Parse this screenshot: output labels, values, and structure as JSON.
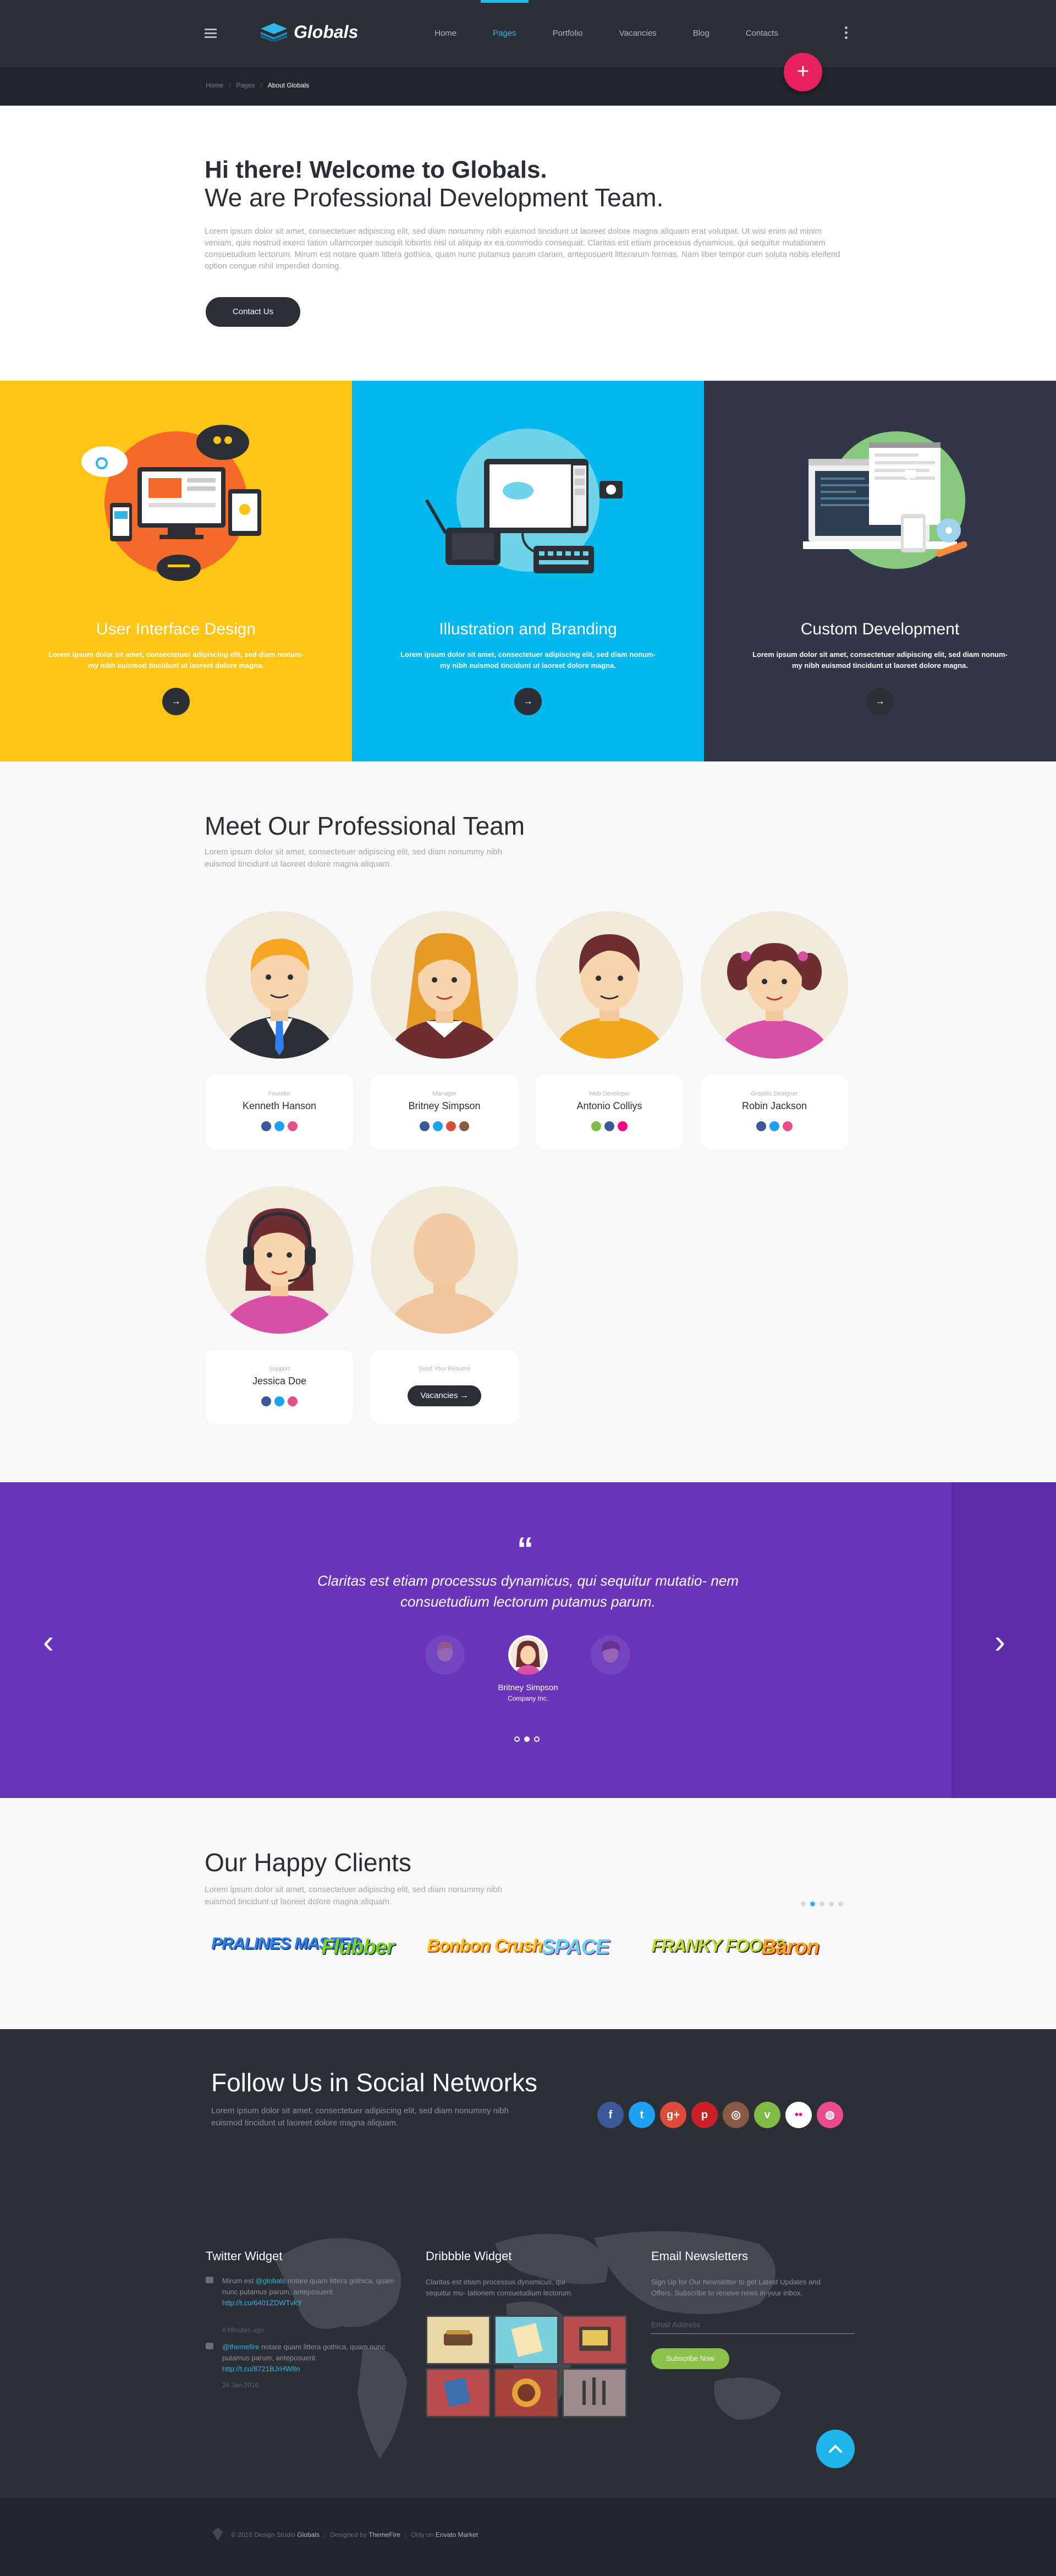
{
  "nav": {
    "logo_text": "Globals",
    "items": [
      "Home",
      "Pages",
      "Portfolio",
      "Vacancies",
      "Blog",
      "Contacts"
    ],
    "active_item": "Pages",
    "icons": {
      "menu": "hamburger-icon",
      "more": "vertical-dots-icon",
      "fab": "plus-icon"
    },
    "fab_label": "+"
  },
  "breadcrumb": {
    "items": [
      "Home",
      "Pages",
      "About Globals"
    ]
  },
  "welcome": {
    "title": "Hi there! Welcome to Globals.",
    "subtitle": "We are Professional Development Team.",
    "body": "Lorem ipsum dolor sit amet, consectetuer adipiscing elit, sed diam nonummy nibh euismod tincidunt ut laoreet dolore magna aliquam erat volutpat. Ut wisi enim ad minim veniam, quis nostrud exerci tation ullamcorper suscipit lobortis nisl ut aliquip ex ea commodo consequat. Claritas est etiam processus dynamicus, qui sequitur mutationem consuetudium lectorum. Mirum est notare quam littera gothica, quam nunc putamus parum claram, anteposuerit litterarum formas. Nam liber tempor cum soluta nobis eleifend option congue nihil imperdiet doming.",
    "button": "Contact Us"
  },
  "services": [
    {
      "title": "User Interface Design",
      "text": "Lorem ipsum dolor sit amet, consectetuer adipiscing elit, sed diam nonum- my nibh euismod tincidunt ut laoreet dolore magna.",
      "color": "#fec516"
    },
    {
      "title": "Illustration and Branding",
      "text": "Lorem ipsum dolor sit amet, consectetuer adipiscing elit, sed diam nonum- my nibh euismod tincidunt ut laoreet dolore magna.",
      "color": "#03b8ec"
    },
    {
      "title": "Custom Development",
      "text": "Lorem ipsum dolor sit amet, consectetuer adipiscing elit, sed diam nonum- my nibh euismod tincidunt ut laoreet dolore magna.",
      "color": "#323646"
    }
  ],
  "team": {
    "title": "Meet Our Professional Team",
    "lead": "Lorem ipsum dolor sit amet, consectetuer adipiscing elit, sed diam nonummy nibh euismod tincidunt ut laoreet dolore magna aliquam.",
    "members": [
      {
        "role": "Founder",
        "name": "Kenneth Hanson",
        "socials": [
          "facebook-icon",
          "twitter-icon",
          "dribbble-icon"
        ]
      },
      {
        "role": "Manager",
        "name": "Britney Simpson",
        "socials": [
          "facebook-icon",
          "twitter-icon",
          "google-plus-icon",
          "instagram-icon"
        ]
      },
      {
        "role": "Web Devoloper",
        "name": "Antonio Colliys",
        "socials": [
          "vine-icon",
          "facebook-icon",
          "flickr-icon"
        ]
      },
      {
        "role": "Graphic Designer",
        "name": "Robin Jackson",
        "socials": [
          "facebook-icon",
          "twitter-icon",
          "dribbble-icon"
        ]
      },
      {
        "role": "Support",
        "name": "Jessica Doe",
        "socials": [
          "facebook-icon",
          "twitter-icon",
          "dribbble-icon"
        ]
      }
    ],
    "vacancy": {
      "label": "Send Your Resume",
      "button": "Vacancies"
    }
  },
  "testimonial": {
    "quote_mark": "“",
    "text": "Claritas est etiam processus dynamicus, qui sequitur mutatio- nem consuetudium lectorum putamus parum.",
    "name": "Britney Simpson",
    "company": "Company Inc.",
    "active_slide": 2,
    "slides": 3,
    "prev": "‹",
    "next": "›"
  },
  "clients": {
    "title": "Our Happy Clients",
    "lead": "Lorem ipsum dolor sit amet, consectetuer adipiscing elit, sed diam nonummy nibh euismod tincidunt ut laoreet dolore magna aliquam.",
    "logos": [
      "PRALINES MASTER",
      "Flubber",
      "Bonbon Crush",
      "SPACE",
      "FRANKY FOODS",
      "Baron"
    ]
  },
  "social": {
    "title": "Follow Us in Social Networks",
    "lead": "Lorem ipsum dolor sit amet, consectetuer adipiscing elit, sed diam nonummy nibh euismod tincidunt ut laoreet dolore magna aliquam.",
    "networks": [
      {
        "icon": "facebook-icon",
        "glyph": "f",
        "color": "#3b5998"
      },
      {
        "icon": "twitter-icon",
        "glyph": "t",
        "color": "#1da1f2"
      },
      {
        "icon": "google-plus-icon",
        "glyph": "g+",
        "color": "#dd4b39"
      },
      {
        "icon": "pinterest-icon",
        "glyph": "p",
        "color": "#cb2027"
      },
      {
        "icon": "instagram-icon",
        "glyph": "◎",
        "color": "#8a5a44"
      },
      {
        "icon": "vine-icon",
        "glyph": "v",
        "color": "#7fba44"
      },
      {
        "icon": "flickr-icon",
        "glyph": "••",
        "color": "#ffffff"
      },
      {
        "icon": "dribbble-icon",
        "glyph": "◍",
        "color": "#ea4c89"
      }
    ]
  },
  "widgets": {
    "twitter": {
      "title": "Twitter Widget",
      "tweets": [
        {
          "pre": "Mirum est ",
          "handle": "@globals",
          "post": " notare quam littera gothica, quam nunc putamus parum, anteposuerit.",
          "link": "http://t.co/6401ZDWTvkY",
          "time": "6 Minutes ago"
        },
        {
          "pre": "",
          "handle": "@themefire",
          "post": " notare quam littera gothica, quam nunc putamus parum, anteposuerit.",
          "link": "http://t.co/8721BJrHW8n",
          "time": "26 Jan 2016"
        }
      ]
    },
    "dribbble": {
      "title": "Dribbble Widget",
      "text": "Claritas est etiam processus dynamicus, qui sequitur mu- tationem consuetudium lectorum."
    },
    "newsletter": {
      "title": "Email Newsletters",
      "text": "Sign Up for Our Newsletter to get Latest Updates and Offers. Subscribe to receive news in your inbox.",
      "placeholder": "Email Address",
      "button": "Subscribe Now"
    }
  },
  "footer": {
    "year": "© 2016 Design Studio",
    "brand": "Globals",
    "designed_by": "Designed by",
    "author": "ThemeFire",
    "sold_at": "Only on",
    "market": "Envato Market"
  }
}
